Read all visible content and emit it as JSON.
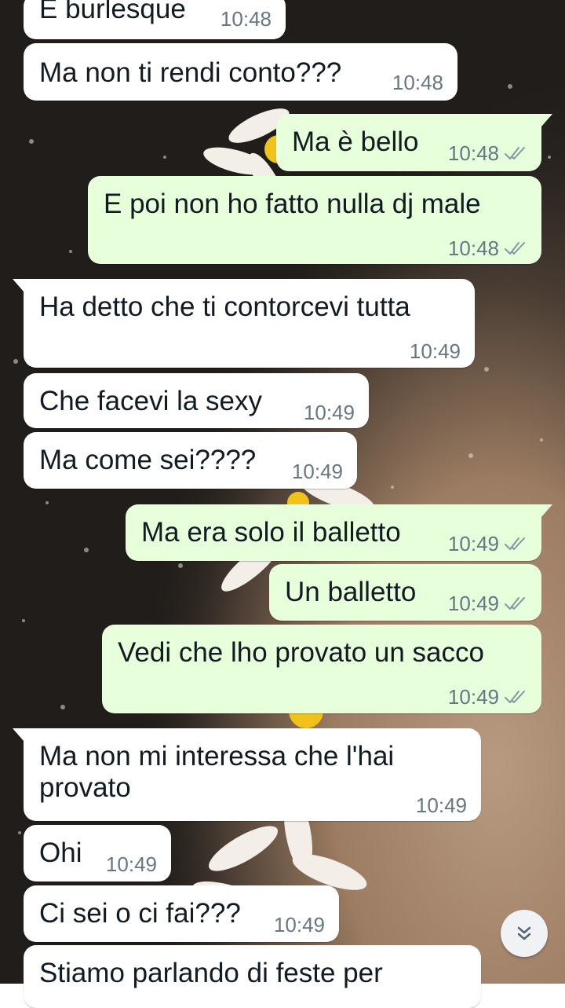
{
  "chat": {
    "messages": [
      {
        "text": "E burlesque",
        "time": "10:48",
        "dir": "in"
      },
      {
        "text": "Ma non ti rendi conto???",
        "time": "10:48",
        "dir": "in"
      },
      {
        "text": "Ma è bello",
        "time": "10:48",
        "dir": "out",
        "status": "read"
      },
      {
        "text": "E poi non ho fatto nulla dj male",
        "time": "10:48",
        "dir": "out",
        "status": "read"
      },
      {
        "text": "Ha detto che ti contorcevi tutta",
        "time": "10:49",
        "dir": "in"
      },
      {
        "text": "Che facevi la sexy",
        "time": "10:49",
        "dir": "in"
      },
      {
        "text": "Ma come sei????",
        "time": "10:49",
        "dir": "in"
      },
      {
        "text": "Ma era solo il balletto",
        "time": "10:49",
        "dir": "out",
        "status": "read"
      },
      {
        "text": "Un balletto",
        "time": "10:49",
        "dir": "out",
        "status": "read"
      },
      {
        "text": "Vedi che lho provato un sacco",
        "time": "10:49",
        "dir": "out",
        "status": "read"
      },
      {
        "text": "Ma non mi interessa che l'hai provato",
        "time": "10:49",
        "dir": "in"
      },
      {
        "text": "Ohi",
        "time": "10:49",
        "dir": "in"
      },
      {
        "text": "Ci sei o ci fai???",
        "time": "10:49",
        "dir": "in"
      },
      {
        "text": "Stiamo parlando di feste per",
        "time": "",
        "dir": "in"
      }
    ],
    "scroll_button_icon": "double-chevron-down-icon"
  },
  "colors": {
    "incoming_bubble": "#ffffff",
    "outgoing_bubble": "#e7ffdb",
    "timestamp": "#667781",
    "read_ticks": "#8696a0",
    "wallpaper_dark": "#201d1a",
    "wallpaper_sand": "#a98a70"
  }
}
